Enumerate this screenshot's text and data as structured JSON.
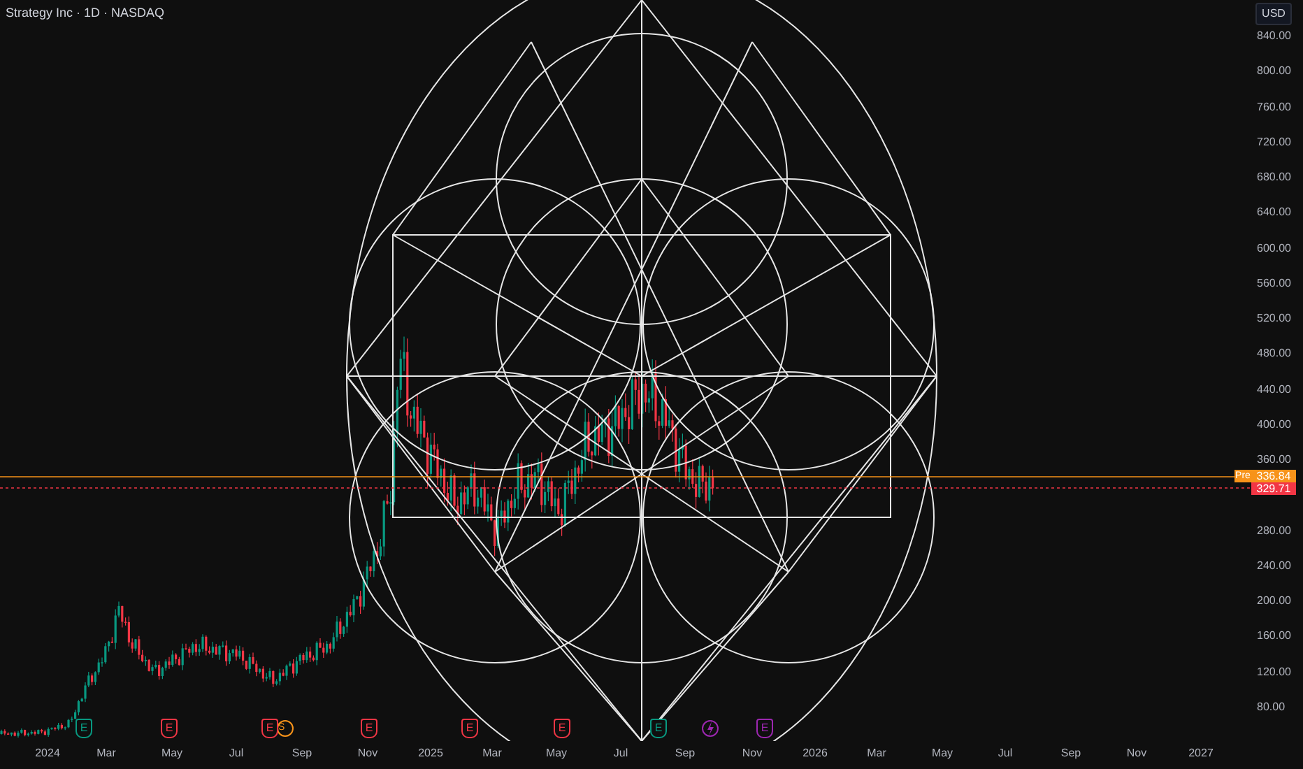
{
  "chart_header": {
    "title": "Strategy Inc · 1D · NASDAQ"
  },
  "price_axis": {
    "currency": "USD",
    "ticks": [
      "840.00",
      "800.00",
      "760.00",
      "720.00",
      "680.00",
      "640.00",
      "600.00",
      "560.00",
      "520.00",
      "480.00",
      "440.00",
      "400.00",
      "360.00",
      "280.00",
      "240.00",
      "200.00",
      "160.00",
      "120.00",
      "80.00"
    ],
    "badges": [
      {
        "kind": "pre",
        "tag": "Pre",
        "value": "336.84",
        "color": "#f7931a"
      },
      {
        "kind": "last",
        "value": "329.71",
        "color": "#f23645"
      }
    ]
  },
  "events": [
    {
      "kind": "earnings",
      "label": "E",
      "color": "#089981"
    },
    {
      "kind": "earnings",
      "label": "E",
      "color": "#f23645"
    },
    {
      "kind": "earnings_split",
      "label": "E",
      "extra": "S",
      "color": "#f23645"
    },
    {
      "kind": "earnings",
      "label": "E",
      "color": "#f23645"
    },
    {
      "kind": "earnings",
      "label": "E",
      "color": "#f23645"
    },
    {
      "kind": "earnings",
      "label": "E",
      "color": "#f23645"
    },
    {
      "kind": "earnings",
      "label": "E",
      "color": "#089981"
    },
    {
      "kind": "flash",
      "color": "#9c27b0"
    },
    {
      "kind": "earnings",
      "label": "E",
      "color": "#9c27b0"
    }
  ],
  "time_axis": {
    "labels": [
      "2024",
      "Mar",
      "May",
      "Jul",
      "Sep",
      "Nov",
      "2025",
      "Mar",
      "May",
      "Jul",
      "Sep",
      "Nov",
      "2026",
      "Mar",
      "May",
      "Jul",
      "Sep",
      "Nov",
      "2027"
    ]
  }
}
